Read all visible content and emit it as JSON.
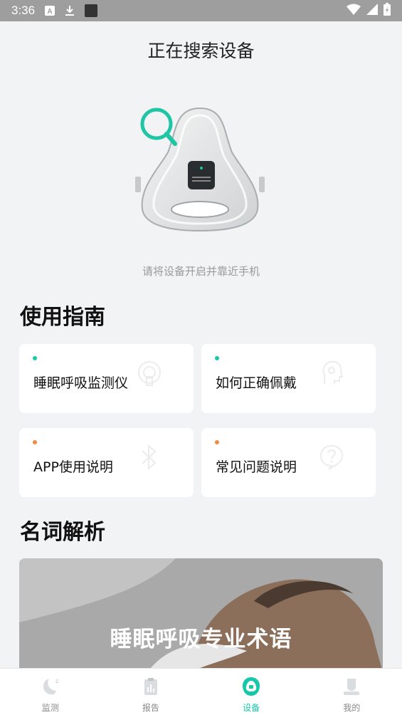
{
  "status_bar": {
    "time": "3:36"
  },
  "page": {
    "title": "正在搜索设备",
    "hint": "请将设备开启并靠近手机"
  },
  "guide": {
    "title": "使用指南",
    "cards": [
      {
        "label": "睡眠呼吸监测仪",
        "dot_color": "#1ec6a5",
        "icon": "device-watermark-icon"
      },
      {
        "label": "如何正确佩戴",
        "dot_color": "#1ec6a5",
        "icon": "head-watermark-icon"
      },
      {
        "label": "APP使用说明",
        "dot_color": "#f08a3c",
        "icon": "bluetooth-watermark-icon"
      },
      {
        "label": "常见问题说明",
        "dot_color": "#f08a3c",
        "icon": "question-watermark-icon"
      }
    ]
  },
  "glossary": {
    "title": "名词解析",
    "banner_text": "睡眠呼吸专业术语"
  },
  "tabbar": {
    "active_color": "#16c7a8",
    "items": [
      {
        "label": "监测",
        "icon": "moon-icon"
      },
      {
        "label": "报告",
        "icon": "report-icon"
      },
      {
        "label": "设备",
        "icon": "device-icon",
        "active": true
      },
      {
        "label": "我的",
        "icon": "profile-icon"
      }
    ]
  }
}
